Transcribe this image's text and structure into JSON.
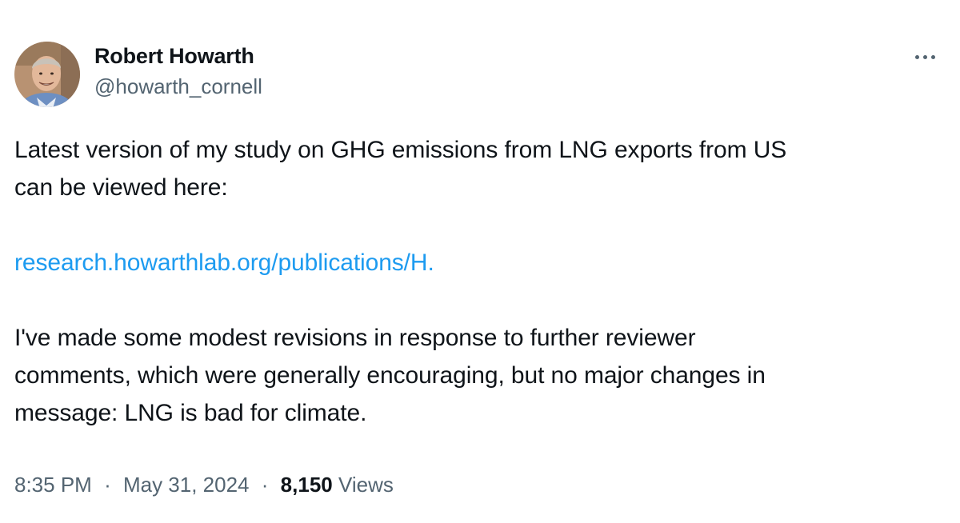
{
  "tweet": {
    "author": {
      "display_name": "Robert Howarth",
      "handle": "@howarth_cornell"
    },
    "body": {
      "paragraph_1": "Latest version of my study on GHG emissions from LNG exports from US\ncan be viewed here:",
      "link_text": "research.howarthlab.org/publications/H.",
      "paragraph_2": "I've made some modest revisions in response to further reviewer\ncomments, which were generally encouraging, but no major changes in\nmessage:  LNG is bad for climate."
    },
    "meta": {
      "time": "8:35 PM",
      "separator": "·",
      "date": "May 31, 2024",
      "views_count": "8,150",
      "views_label": "Views"
    }
  },
  "colors": {
    "link": "#1d9bf0",
    "secondary_text": "#536471",
    "primary_text": "#0f1419"
  },
  "icons": {
    "more": "more-horizontal-icon",
    "avatar": "profile-photo"
  }
}
